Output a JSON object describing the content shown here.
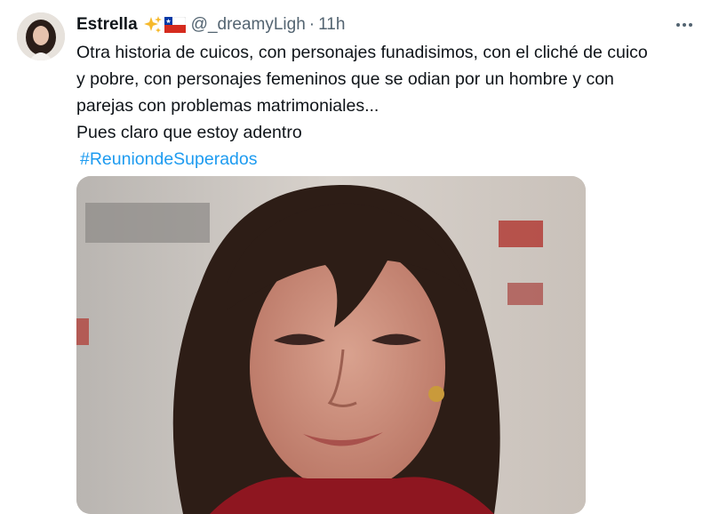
{
  "tweet": {
    "author_name": "Estrella",
    "author_handle": "@_dreamyLigh",
    "separator": "·",
    "time": "11h",
    "text_lines": [
      "Otra historia de cuicos, con personajes funadisimos, con el cliché de cuico",
      "y pobre, con personajes femeninos que se odian por un hombre y con",
      "parejas con problemas matrimoniales...",
      "Pues claro que estoy adentro"
    ],
    "hashtag": "#ReuniondeSuperados",
    "badges": [
      "sparkles-icon",
      "chile-flag-icon"
    ],
    "more_icon": "more-horizontal-icon",
    "media_description_icon": "tweet-media-image"
  },
  "colors": {
    "link": "#1d9bf0",
    "secondary_text": "#536471",
    "primary_text": "#0f1419"
  }
}
